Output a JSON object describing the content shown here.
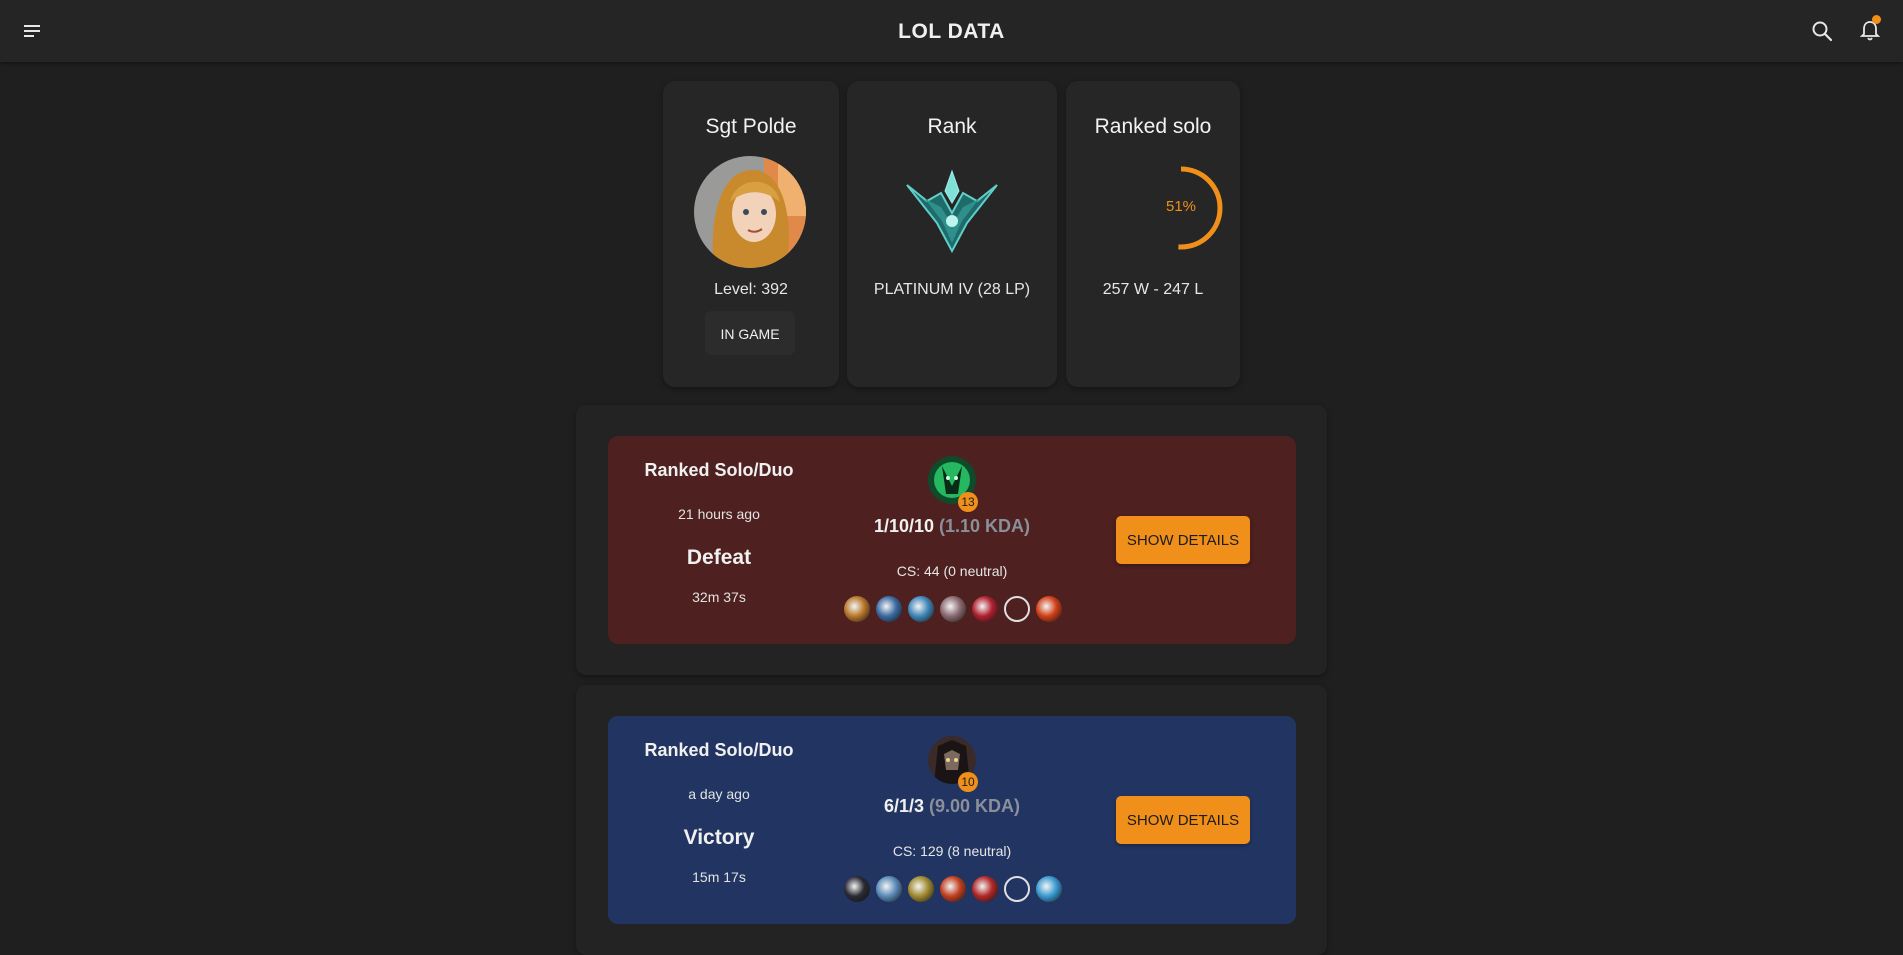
{
  "appbar": {
    "title": "LOL DATA",
    "icons": [
      "menu-icon",
      "search-icon",
      "bell-icon"
    ],
    "notification_dot_color": "#f0901a"
  },
  "summoner": {
    "name": "Sgt Polde",
    "level_text": "Level: 392",
    "status_label": "IN GAME"
  },
  "rank": {
    "title": "Rank",
    "tier_text": "PLATINUM IV (28 LP)"
  },
  "ranked_solo": {
    "title": "Ranked solo",
    "winrate_percent": 51,
    "winrate_text": "51%",
    "record_text": "257 W - 247 L"
  },
  "accent_color": "#f0901a",
  "matches": [
    {
      "queue": "Ranked Solo/Duo",
      "time_ago": "21 hours ago",
      "result": "Defeat",
      "duration": "32m 37s",
      "champion_level": "13",
      "kda": "1/10/10",
      "kda_ratio": "(1.10 KDA)",
      "cs": "CS: 44 (0 neutral)",
      "details_label": "SHOW DETAILS",
      "background": "#4e2020",
      "item_colors": [
        "#b8772a",
        "#3a6aa0",
        "#3f86b8",
        "#8a6a70",
        "#b02030",
        "empty",
        "#d04018"
      ]
    },
    {
      "queue": "Ranked Solo/Duo",
      "time_ago": "a day ago",
      "result": "Victory",
      "duration": "15m 17s",
      "champion_level": "10",
      "kda": "6/1/3",
      "kda_ratio": "(9.00 KDA)",
      "cs": "CS: 129 (8 neutral)",
      "details_label": "SHOW DETAILS",
      "background": "#223562",
      "item_colors": [
        "#2a2a34",
        "#5a8ab8",
        "#a08a30",
        "#c04020",
        "#b02828",
        "empty",
        "#3a9ad0"
      ]
    }
  ]
}
